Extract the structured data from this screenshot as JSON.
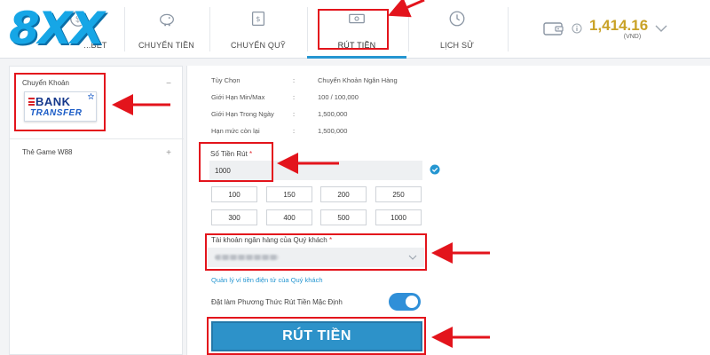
{
  "brand": {
    "logo": "8XX"
  },
  "tabs": [
    {
      "label": "...BET",
      "icon": "dollar-icon"
    },
    {
      "label": "CHUYỂN TIỀN",
      "icon": "piggy-bank-icon"
    },
    {
      "label": "CHUYỂN QUỸ",
      "icon": "transfer-icon"
    },
    {
      "label": "RÚT TIỀN",
      "icon": "withdraw-icon",
      "active": true
    },
    {
      "label": "LỊCH SỬ",
      "icon": "clock-icon"
    }
  ],
  "balance": {
    "amount": "1,414.16",
    "currency": "(VND)"
  },
  "left_panel": {
    "transfer_label": "Chuyển Khoản",
    "transfer_sign": "−",
    "bank_card": {
      "line1": "BANK",
      "line2": "TRANSFER"
    },
    "game_card_label": "Thẻ Game W88",
    "game_card_sign": "+"
  },
  "info": [
    {
      "key": "Tùy Chọn",
      "value": "Chuyển Khoản Ngân Hàng"
    },
    {
      "key": "Giới Hạn Min/Max",
      "value": "100 / 100,000"
    },
    {
      "key": "Giới Hạn Trong Ngày",
      "value": "1,500,000"
    },
    {
      "key": "Hạn mức còn lại",
      "value": "1,500,000"
    }
  ],
  "amount": {
    "label": "Số Tiền Rút",
    "required": "*",
    "value": "1000"
  },
  "quick_amounts": [
    "100",
    "150",
    "200",
    "250",
    "300",
    "400",
    "500",
    "1000"
  ],
  "account": {
    "label": "Tài khoản ngân hàng của Quý khách",
    "required": "*"
  },
  "ewallet_link": "Quản lý ví tiền điện tử của Quý khách",
  "default_method": {
    "label": "Đặt làm Phương Thức Rút Tiền Mặc Định",
    "enabled": true
  },
  "submit_label": "RÚT TIỀN",
  "colors": {
    "accent": "#2596d1",
    "annotation": "#e3141c",
    "balance": "#c9a227"
  }
}
